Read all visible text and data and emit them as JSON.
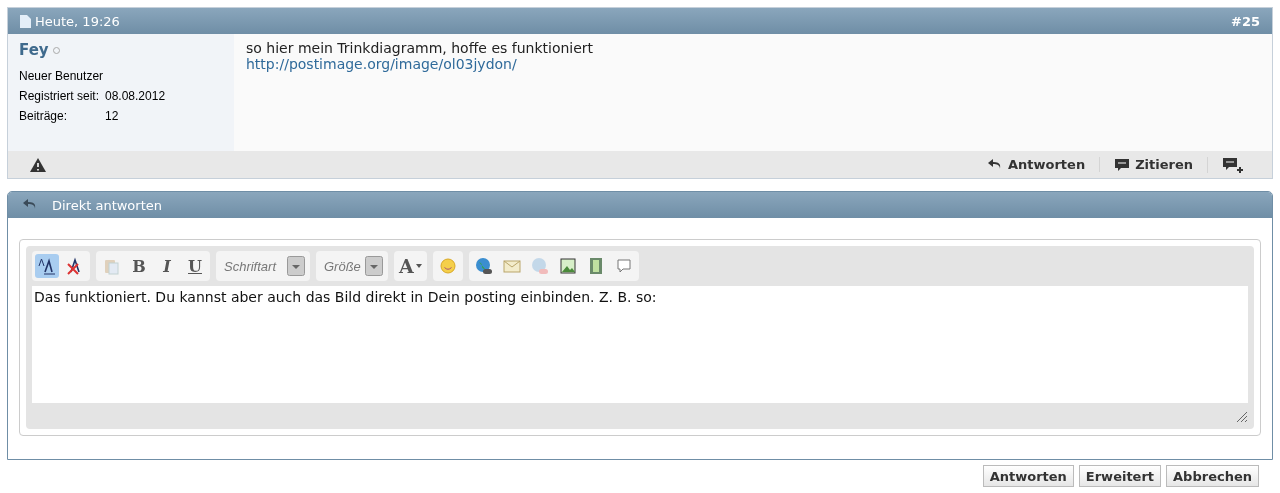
{
  "post": {
    "date": "Heute, 19:26",
    "number": "#25",
    "user": {
      "name": "Fey",
      "online": false,
      "title": "Neuer Benutzer",
      "fields": [
        {
          "label": "Registriert seit:",
          "value": "08.08.2012"
        },
        {
          "label": "Beiträge:",
          "value": "12"
        }
      ]
    },
    "text": "so hier mein Trinkdiagramm, hoffe es funktioniert",
    "link": "http://postimage.org/image/ol03jydon/",
    "actions": [
      {
        "kind": "reply",
        "label": "Antworten"
      },
      {
        "kind": "quote",
        "label": "Zitieren"
      },
      {
        "kind": "multiquote"
      }
    ]
  },
  "quick_reply": {
    "title": "Direkt antworten",
    "toolbar": [
      [
        {
          "kind": "toggle",
          "selected": true
        },
        {
          "kind": "removeformat"
        }
      ],
      [
        {
          "kind": "paste",
          "disabled": true
        },
        {
          "kind": "format",
          "label": "B"
        },
        {
          "kind": "format",
          "label": "I"
        },
        {
          "kind": "format",
          "label": "U"
        }
      ],
      [
        {
          "kind": "select",
          "placeholder": "Schriftart"
        }
      ],
      [
        {
          "kind": "select",
          "placeholder": "Größe"
        }
      ],
      [
        {
          "kind": "color",
          "label": "A"
        }
      ],
      [
        {
          "kind": "smilie"
        }
      ],
      [
        {
          "kind": "link"
        },
        {
          "kind": "email"
        },
        {
          "kind": "unlink",
          "disabled": true
        },
        {
          "kind": "image"
        },
        {
          "kind": "video"
        },
        {
          "kind": "quote"
        }
      ]
    ],
    "message": "Das funktioniert. Du kannst aber auch das Bild direkt in Dein posting einbinden. Z. B. so:",
    "buttons": [
      "Antworten",
      "Erweitert",
      "Abbrechen"
    ]
  }
}
